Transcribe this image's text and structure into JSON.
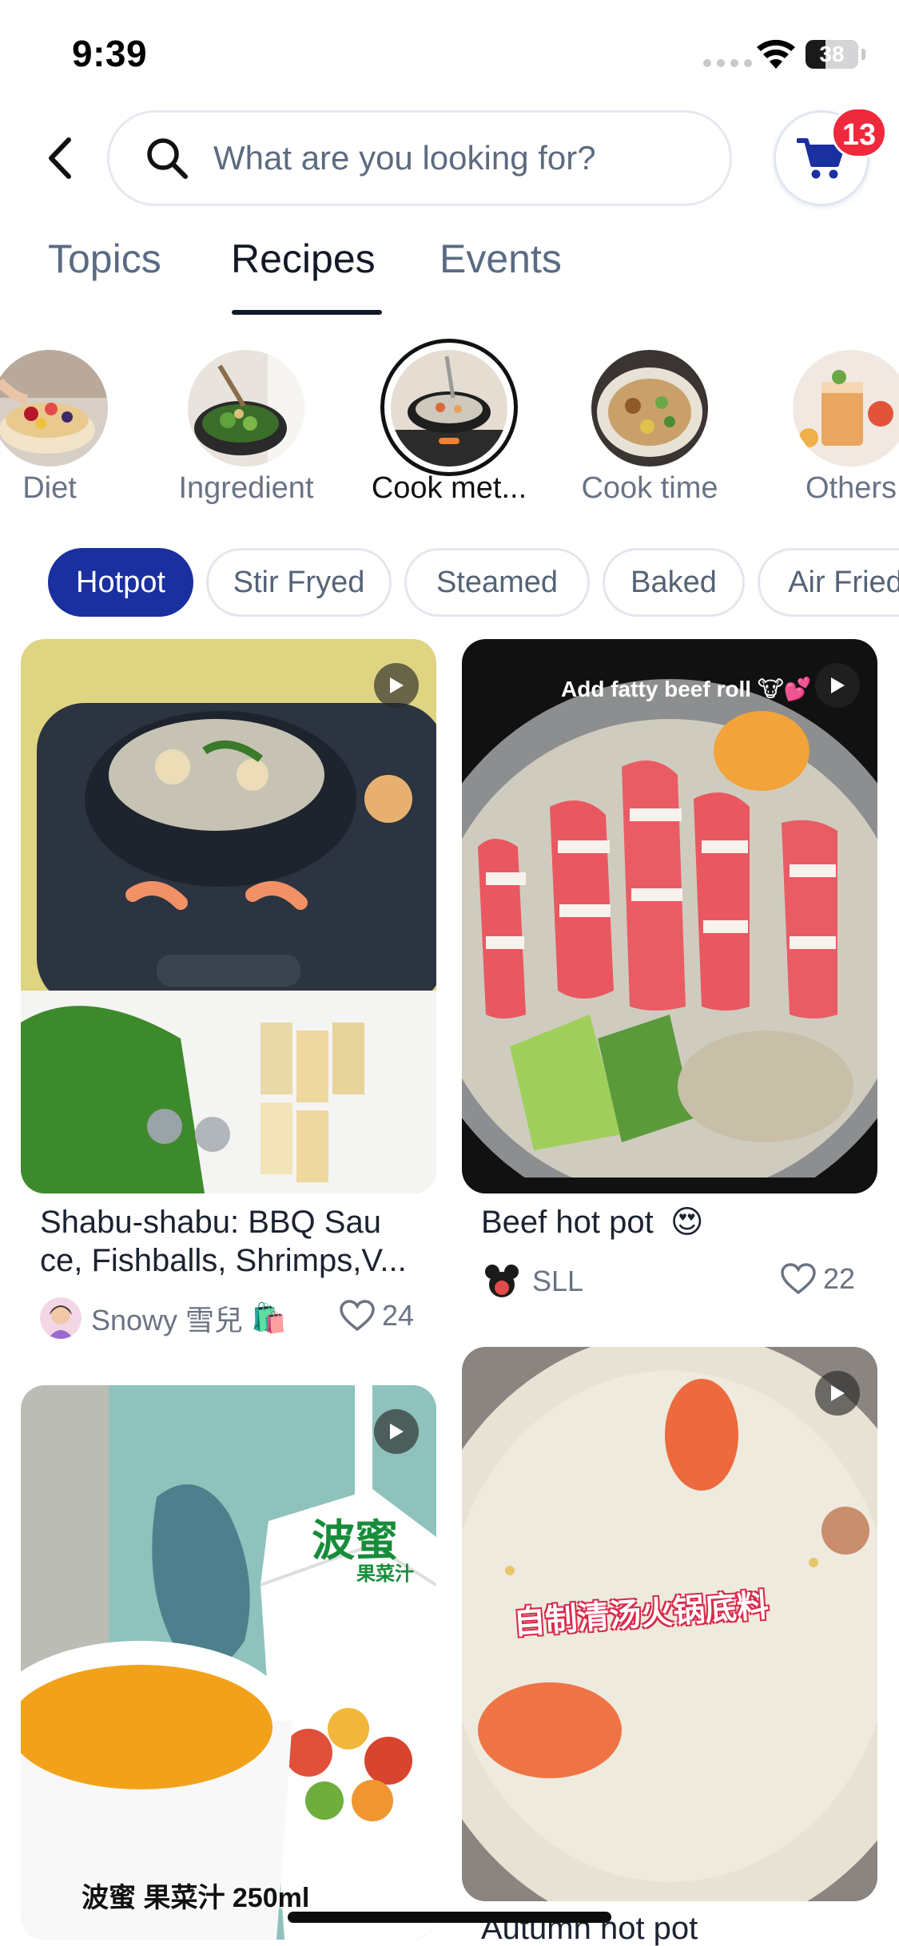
{
  "status_bar": {
    "time": "9:39",
    "battery": "38",
    "battery_level": 0.38
  },
  "search": {
    "placeholder": "What are you looking for?"
  },
  "cart": {
    "badge_count": "13"
  },
  "tabs": [
    {
      "label": "Topics",
      "selected": false
    },
    {
      "label": "Recipes",
      "selected": true
    },
    {
      "label": "Events",
      "selected": false
    }
  ],
  "categories": [
    {
      "label": "Diet",
      "selected": false
    },
    {
      "label": "Ingredient",
      "selected": false
    },
    {
      "label": "Cook met...",
      "selected": true
    },
    {
      "label": "Cook time",
      "selected": false
    },
    {
      "label": "Others",
      "selected": false
    }
  ],
  "chips": [
    {
      "label": "Hotpot",
      "active": true
    },
    {
      "label": "Stir Fryed",
      "active": false
    },
    {
      "label": "Steamed",
      "active": false
    },
    {
      "label": "Baked",
      "active": false
    },
    {
      "label": "Air Fried",
      "active": false
    }
  ],
  "posts": [
    {
      "title_line1": "Shabu-shabu: BBQ Sau",
      "title_line2": "ce, Fishballs, Shrimps,V...",
      "author": "Snowy 雪兒",
      "author_emoji": "🛍️",
      "likes": "24",
      "is_video": true
    },
    {
      "overlay_text": "Add fatty beef roll 🐮💕",
      "title_line1": "Beef hot pot",
      "title_emoji": "😍",
      "author": "SLL",
      "likes": "22",
      "is_video": true
    },
    {
      "overlay_text": "波蜜 果菜汁 250ml",
      "package_text": "波蜜",
      "package_sub": "果菜汁",
      "is_video": true
    },
    {
      "overlay_text": "自制清汤火锅底料",
      "title_line1": "Autumn hot pot",
      "is_video": true
    }
  ],
  "colors": {
    "accent": "#1a2fa0",
    "badge": "#f0283c",
    "text_primary": "#121826",
    "text_secondary": "#5a6b84"
  },
  "icons": [
    "back-icon",
    "search-icon",
    "cart-icon",
    "play-icon",
    "heart-icon",
    "wifi-icon"
  ]
}
